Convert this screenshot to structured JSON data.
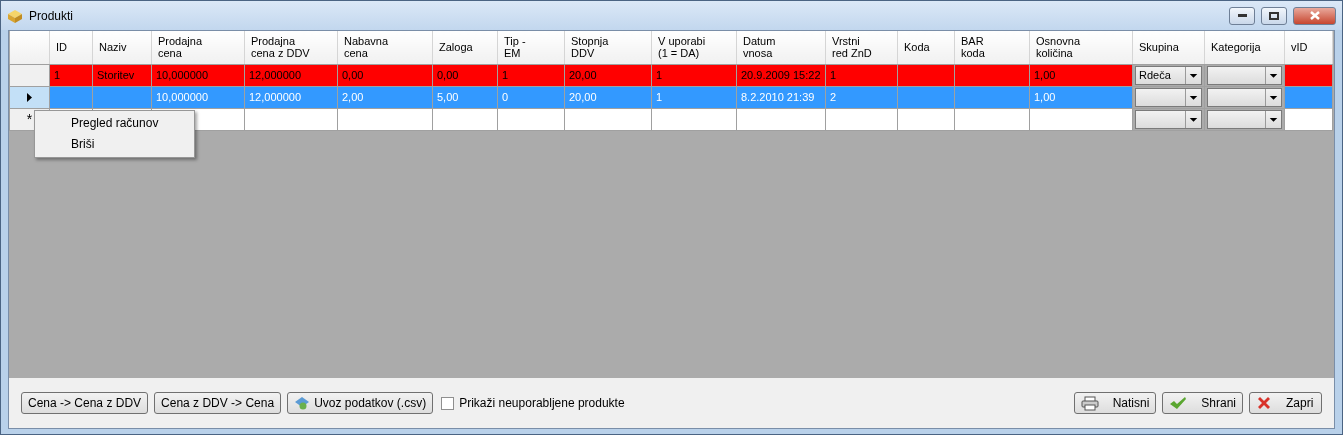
{
  "window": {
    "title": "Produkti"
  },
  "table": {
    "columns": [
      "ID",
      "Naziv",
      "Prodajna\ncena",
      "Prodajna\ncena z DDV",
      "Nabavna\ncena",
      "Zaloga",
      "Tip -\nEM",
      "Stopnja\nDDV",
      "V uporabi\n(1 = DA)",
      "Datum\nvnosa",
      "Vrstni\nred ZnD",
      "Koda",
      "BAR\nkoda",
      "Osnovna\nkoličina",
      "Skupina",
      "Kategorija",
      "vID"
    ],
    "rows": [
      {
        "kind": "data",
        "selected": false,
        "color": "#ff0000",
        "cells": [
          "1",
          "Storitev",
          "10,000000",
          "12,000000",
          "0,00",
          "0,00",
          "1",
          "20,00",
          "1",
          "20.9.2009 15:22",
          "1",
          null,
          null,
          "1,00"
        ],
        "skupina": "Rdeča"
      },
      {
        "kind": "data",
        "selected": true,
        "cells": [
          null,
          null,
          "10,000000",
          "12,000000",
          "2,00",
          "5,00",
          "0",
          "20,00",
          "1",
          "8.2.2010 21:39",
          "2",
          null,
          null,
          "1,00"
        ]
      },
      {
        "kind": "new",
        "selected": false,
        "marker": "*"
      }
    ]
  },
  "context_menu": {
    "items": [
      "Pregled računov",
      "Briši"
    ]
  },
  "bottom_bar": {
    "left_buttons": [
      {
        "label": "Cena -> Cena z DDV"
      },
      {
        "label": "Cena z DDV -> Cena"
      },
      {
        "label": "Uvoz podatkov (.csv)"
      }
    ],
    "checkbox": {
      "label": "Prikaži neuporabljene produkte",
      "checked": false
    },
    "right_buttons": [
      {
        "label": "Natisni"
      },
      {
        "label": "Shrani"
      },
      {
        "label": "Zapri"
      }
    ]
  }
}
